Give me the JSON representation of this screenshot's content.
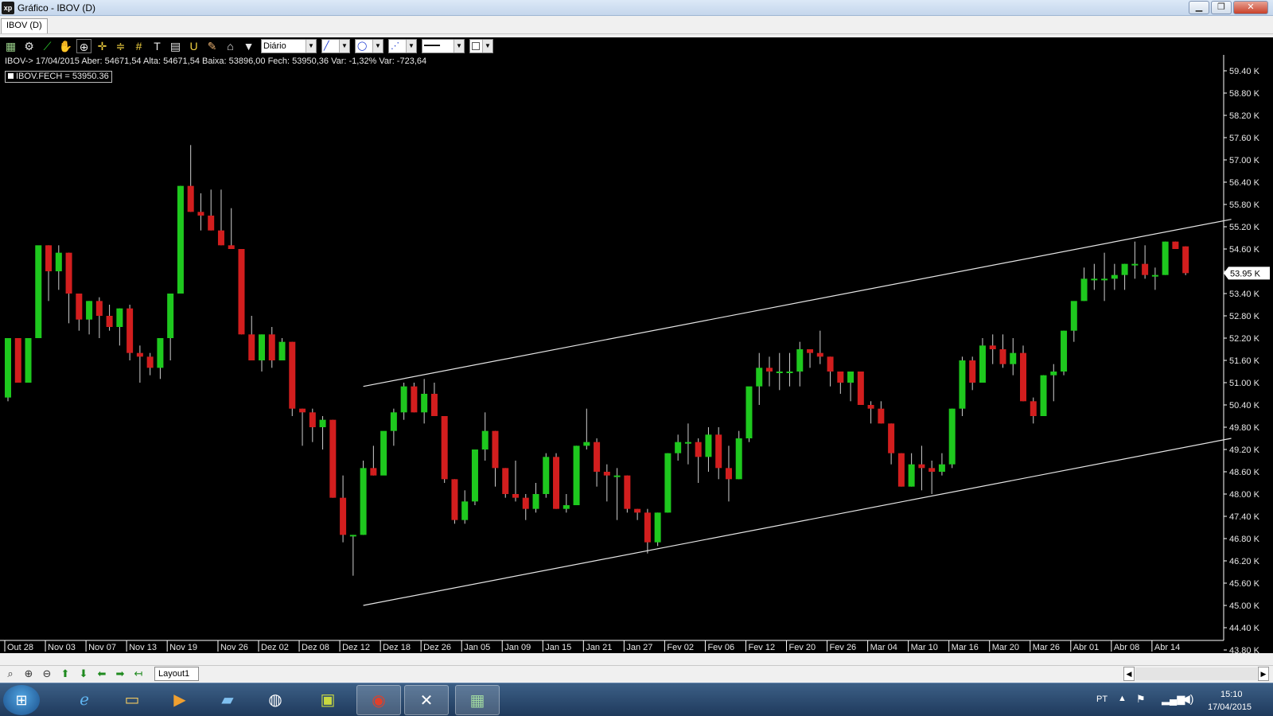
{
  "window": {
    "title": "Gráfico - IBOV (D)",
    "app_icon_label": "xp",
    "minimize_label": "▁",
    "restore_label": "❐",
    "close_label": "✕"
  },
  "tabs": [
    {
      "label": "IBOV (D)"
    }
  ],
  "toolbar": {
    "period_select": "Diário",
    "icons": [
      "bar-chart-icon",
      "gear-icon",
      "line-tool-icon",
      "hand-icon",
      "zoom-chart-icon",
      "crosshair-icon",
      "horizontal-lines-icon",
      "grid-icon",
      "text-tool-icon",
      "calculator-icon",
      "magnet-icon",
      "brush-icon",
      "lock-icon",
      "filter-icon"
    ]
  },
  "info_line": "IBOV-> 17/04/2015 Aber: 54671,54 Alta: 54671,54 Baixa: 53896,00 Fech: 53950,36 Var: -1,32% Var: -723,64",
  "legend": "IBOV.FECH = 53950.36",
  "bottom": {
    "layout_tab": "Layout1"
  },
  "taskbar": {
    "language": "PT",
    "time": "15:10",
    "date": "17/04/2015"
  },
  "chart_data": {
    "type": "candlestick",
    "symbol": "IBOV",
    "ylim": [
      43800,
      59400
    ],
    "y_ticks": [
      "59.40 K",
      "58.80 K",
      "58.20 K",
      "57.60 K",
      "57.00 K",
      "56.40 K",
      "55.80 K",
      "55.20 K",
      "54.60 K",
      "54.00 K",
      "53.40 K",
      "52.80 K",
      "52.20 K",
      "51.60 K",
      "51.00 K",
      "50.40 K",
      "49.80 K",
      "49.20 K",
      "48.60 K",
      "48.00 K",
      "47.40 K",
      "46.80 K",
      "46.20 K",
      "45.60 K",
      "45.00 K",
      "44.40 K",
      "43.80 K"
    ],
    "last_price_label": "53.95 K",
    "last_price": 53950,
    "x_ticks": [
      {
        "label": "Out 28",
        "index": 0
      },
      {
        "label": "Nov 03",
        "index": 4
      },
      {
        "label": "Nov 07",
        "index": 8
      },
      {
        "label": "Nov 13",
        "index": 12
      },
      {
        "label": "Nov 19",
        "index": 16
      },
      {
        "label": "Nov 26",
        "index": 21
      },
      {
        "label": "Dez 02",
        "index": 25
      },
      {
        "label": "Dez 08",
        "index": 29
      },
      {
        "label": "Dez 12",
        "index": 33
      },
      {
        "label": "Dez 18",
        "index": 37
      },
      {
        "label": "Dez 26",
        "index": 41
      },
      {
        "label": "Jan 05",
        "index": 45
      },
      {
        "label": "Jan 09",
        "index": 49
      },
      {
        "label": "Jan 15",
        "index": 53
      },
      {
        "label": "Jan 21",
        "index": 57
      },
      {
        "label": "Jan 27",
        "index": 61
      },
      {
        "label": "Fev 02",
        "index": 65
      },
      {
        "label": "Fev 06",
        "index": 69
      },
      {
        "label": "Fev 12",
        "index": 73
      },
      {
        "label": "Fev 20",
        "index": 77
      },
      {
        "label": "Fev 26",
        "index": 81
      },
      {
        "label": "Mar 04",
        "index": 85
      },
      {
        "label": "Mar 10",
        "index": 89
      },
      {
        "label": "Mar 16",
        "index": 93
      },
      {
        "label": "Mar 20",
        "index": 97
      },
      {
        "label": "Mar 26",
        "index": 101
      },
      {
        "label": "Abr 01",
        "index": 105
      },
      {
        "label": "Abr 08",
        "index": 109
      },
      {
        "label": "Abr 14",
        "index": 113
      }
    ],
    "candles": [
      [
        50600,
        52200,
        50500,
        52200
      ],
      [
        52200,
        52200,
        51000,
        51000
      ],
      [
        51000,
        52200,
        51000,
        52200
      ],
      [
        52200,
        54000,
        52200,
        54700
      ],
      [
        54700,
        54700,
        53200,
        54000
      ],
      [
        54000,
        54700,
        53500,
        54500
      ],
      [
        54500,
        54500,
        52600,
        53400
      ],
      [
        53400,
        53400,
        52400,
        52700
      ],
      [
        52700,
        53200,
        52300,
        53200
      ],
      [
        53200,
        53300,
        52200,
        52800
      ],
      [
        52800,
        53100,
        52400,
        52500
      ],
      [
        52500,
        53000,
        52000,
        53000
      ],
      [
        53000,
        53100,
        51600,
        51800
      ],
      [
        51800,
        52000,
        51000,
        51700
      ],
      [
        51700,
        51800,
        51200,
        51400
      ],
      [
        51400,
        52200,
        51100,
        52200
      ],
      [
        52200,
        53400,
        51600,
        53400
      ],
      [
        53400,
        56300,
        53400,
        56300
      ],
      [
        56300,
        57400,
        55600,
        55600
      ],
      [
        55600,
        56100,
        55100,
        55500
      ],
      [
        55500,
        56200,
        55100,
        55100
      ],
      [
        55100,
        56200,
        54700,
        54700
      ],
      [
        54700,
        55700,
        54600,
        54600
      ],
      [
        54600,
        54600,
        52300,
        52300
      ],
      [
        52300,
        52800,
        51600,
        51600
      ],
      [
        51600,
        52300,
        51300,
        52300
      ],
      [
        52300,
        52500,
        51400,
        51600
      ],
      [
        51600,
        52200,
        51600,
        52100
      ],
      [
        52100,
        52100,
        50100,
        50300
      ],
      [
        50300,
        50300,
        49300,
        50200
      ],
      [
        50200,
        50300,
        49400,
        49800
      ],
      [
        49800,
        50100,
        49200,
        50000
      ],
      [
        50000,
        50000,
        47900,
        47900
      ],
      [
        47900,
        48500,
        46700,
        46900
      ],
      [
        46900,
        46900,
        45800,
        46900
      ],
      [
        46900,
        48900,
        46900,
        48700
      ],
      [
        48700,
        49300,
        48500,
        48500
      ],
      [
        48500,
        49600,
        48600,
        49700
      ],
      [
        49700,
        50300,
        49300,
        50200
      ],
      [
        50200,
        51000,
        50000,
        50900
      ],
      [
        50900,
        51000,
        50200,
        50200
      ],
      [
        50200,
        51100,
        49900,
        50700
      ],
      [
        50700,
        51000,
        50100,
        50100
      ],
      [
        50100,
        50100,
        48300,
        48400
      ],
      [
        48400,
        48400,
        47200,
        47300
      ],
      [
        47300,
        48100,
        47200,
        47800
      ],
      [
        47800,
        49100,
        47700,
        49200
      ],
      [
        49200,
        50200,
        48900,
        49700
      ],
      [
        49700,
        49700,
        48200,
        48700
      ],
      [
        48700,
        48700,
        47900,
        48000
      ],
      [
        48000,
        48900,
        47800,
        47900
      ],
      [
        47900,
        48000,
        47300,
        47600
      ],
      [
        47600,
        48300,
        47500,
        48000
      ],
      [
        48000,
        49100,
        47900,
        49000
      ],
      [
        49000,
        49100,
        47600,
        47600
      ],
      [
        47600,
        48000,
        47500,
        47700
      ],
      [
        47700,
        49300,
        47700,
        49300
      ],
      [
        49300,
        50300,
        49200,
        49400
      ],
      [
        49400,
        49500,
        48200,
        48600
      ],
      [
        48600,
        48800,
        47800,
        48500
      ],
      [
        48500,
        48700,
        47300,
        48500
      ],
      [
        48500,
        48500,
        47500,
        47600
      ],
      [
        47600,
        47600,
        47300,
        47500
      ],
      [
        47500,
        47600,
        46400,
        46700
      ],
      [
        46700,
        47500,
        46600,
        47500
      ],
      [
        47500,
        49100,
        47500,
        49100
      ],
      [
        49100,
        49600,
        48900,
        49400
      ],
      [
        49400,
        49900,
        48800,
        49400
      ],
      [
        49400,
        49500,
        48300,
        49000
      ],
      [
        49000,
        49800,
        48600,
        49600
      ],
      [
        49600,
        49800,
        48400,
        48700
      ],
      [
        48700,
        49300,
        47800,
        48400
      ],
      [
        48400,
        49700,
        48400,
        49500
      ],
      [
        49500,
        50800,
        49400,
        50900
      ],
      [
        50900,
        51800,
        50400,
        51400
      ],
      [
        51400,
        51700,
        50900,
        51300
      ],
      [
        51300,
        51800,
        50800,
        51300
      ],
      [
        51300,
        51800,
        50900,
        51300
      ],
      [
        51300,
        52100,
        50900,
        51900
      ],
      [
        51900,
        51900,
        51400,
        51800
      ],
      [
        51800,
        52400,
        51500,
        51700
      ],
      [
        51700,
        51700,
        50900,
        51300
      ],
      [
        51300,
        51300,
        50700,
        51000
      ],
      [
        51000,
        51200,
        50500,
        51300
      ],
      [
        51300,
        51300,
        50400,
        50400
      ],
      [
        50400,
        50500,
        49900,
        50300
      ],
      [
        50300,
        50500,
        49900,
        49900
      ],
      [
        49900,
        49900,
        48800,
        49100
      ],
      [
        49100,
        49100,
        48200,
        48200
      ],
      [
        48200,
        49100,
        48200,
        48800
      ],
      [
        48800,
        49300,
        48100,
        48700
      ],
      [
        48700,
        48900,
        48000,
        48600
      ],
      [
        48600,
        49100,
        48500,
        48800
      ],
      [
        48800,
        50300,
        48700,
        50300
      ],
      [
        50300,
        51700,
        50100,
        51600
      ],
      [
        51600,
        51700,
        50800,
        51000
      ],
      [
        51000,
        52200,
        51000,
        52000
      ],
      [
        52000,
        52300,
        51500,
        51900
      ],
      [
        51900,
        52300,
        51400,
        51500
      ],
      [
        51500,
        52200,
        51200,
        51800
      ],
      [
        51800,
        52000,
        50500,
        50500
      ],
      [
        50500,
        50600,
        49900,
        50100
      ],
      [
        50100,
        51200,
        50100,
        51200
      ],
      [
        51200,
        51500,
        50500,
        51300
      ],
      [
        51300,
        52400,
        51200,
        52400
      ],
      [
        52400,
        53100,
        52100,
        53200
      ],
      [
        53200,
        54100,
        53200,
        53800
      ],
      [
        53800,
        54200,
        53500,
        53800
      ],
      [
        53800,
        54500,
        53200,
        53800
      ],
      [
        53800,
        54200,
        53500,
        53900
      ],
      [
        53900,
        54200,
        53500,
        54200
      ],
      [
        54200,
        54800,
        53800,
        54200
      ],
      [
        54200,
        54700,
        53800,
        53900
      ],
      [
        53900,
        54100,
        53500,
        53900
      ],
      [
        53900,
        54800,
        53900,
        54800
      ],
      [
        54800,
        54800,
        54600,
        54600
      ],
      [
        54671,
        54671,
        53896,
        53950
      ]
    ],
    "trendlines": [
      {
        "name": "upper",
        "from": {
          "index": 35,
          "price": 50900
        },
        "to": {
          "index": 120.5,
          "price": 55400
        }
      },
      {
        "name": "lower",
        "from": {
          "index": 35,
          "price": 45000
        },
        "to": {
          "index": 120.5,
          "price": 49500
        }
      }
    ],
    "colors": {
      "up": "#1ec81e",
      "down": "#d21e1e",
      "wick": "#cfcfcf",
      "background": "#000000",
      "trendline": "#e6e6e6"
    }
  }
}
